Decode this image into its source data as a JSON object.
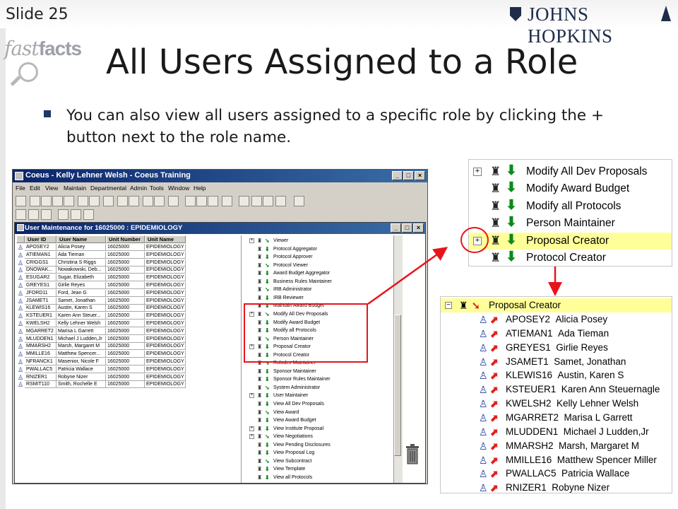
{
  "slide": {
    "number": "Slide 25",
    "brand": "JOHNS HOPKINS",
    "logo_left": "fast",
    "logo_right": "facts",
    "title": "All Users Assigned to a Role",
    "bullet": "You can also view all users assigned to a specific role by clicking the + button next to the role name."
  },
  "colors": {
    "accent_red": "#e8141a",
    "titlebar": "#0a246a",
    "highlight": "#ffff99",
    "green_arrow": "#0a8a1a"
  },
  "app": {
    "title": "Coeus  -  Kelly Lehner Welsh  -  Coeus Training",
    "menu": [
      "File",
      "Edit",
      "View",
      "Maintain",
      "Departmental",
      "Admin",
      "Tools",
      "Window",
      "Help"
    ],
    "inner_title": "User Maintenance for 16025000 : EPIDEMIOLOGY",
    "columns": [
      "User ID",
      "User Name",
      "Unit Number",
      "Unit Name"
    ],
    "users": [
      [
        "APOSEY2",
        "Alicia Posey",
        "16025000",
        "EPIDEMIOLOGY"
      ],
      [
        "ATIEMAN1",
        "Ada Tieman",
        "16025000",
        "EPIDEMIOLOGY"
      ],
      [
        "CRIGGS1",
        "Christina S Riggs",
        "16025000",
        "EPIDEMIOLOGY"
      ],
      [
        "DNOWAK...",
        "Nowakowski, Deb...",
        "16025000",
        "EPIDEMIOLOGY"
      ],
      [
        "ESUGAR2",
        "Sugar, Elizabeth",
        "16025000",
        "EPIDEMIOLOGY"
      ],
      [
        "GREYES1",
        "Girlie Reyes",
        "16025000",
        "EPIDEMIOLOGY"
      ],
      [
        "JFORD11",
        "Ford, Jean G",
        "16025000",
        "EPIDEMIOLOGY"
      ],
      [
        "JSAMET1",
        "Samet, Jonathan",
        "16025000",
        "EPIDEMIOLOGY"
      ],
      [
        "KLEWIS16",
        "Austin, Karen S",
        "16025000",
        "EPIDEMIOLOGY"
      ],
      [
        "KSTEUER1",
        "Karen Ann Steuer...",
        "16025000",
        "EPIDEMIOLOGY"
      ],
      [
        "KWELSH2",
        "Kelly Lehner Welsh",
        "16025000",
        "EPIDEMIOLOGY"
      ],
      [
        "MGARRET2",
        "Marisa L Garrett",
        "16025000",
        "EPIDEMIOLOGY"
      ],
      [
        "MLUDDEN1",
        "Michael J Ludden,Jr",
        "16025000",
        "EPIDEMIOLOGY"
      ],
      [
        "MMARSH2",
        "Marsh, Margaret M",
        "16025000",
        "EPIDEMIOLOGY"
      ],
      [
        "MMILLE16",
        "Matthew Spencer...",
        "16025000",
        "EPIDEMIOLOGY"
      ],
      [
        "NFRANCK1",
        "Masenior, Nicole F",
        "16025000",
        "EPIDEMIOLOGY"
      ],
      [
        "PWALLAC5",
        "Patricia Wallace",
        "16025000",
        "EPIDEMIOLOGY"
      ],
      [
        "RNIZER1",
        "Robyne Nizer",
        "16025000",
        "EPIDEMIOLOGY"
      ],
      [
        "RSMIT110",
        "Smith, Rochelle E",
        "16025000",
        "EPIDEMIOLOGY"
      ]
    ],
    "roles": [
      {
        "label": "Viewer",
        "plus": true
      },
      {
        "label": "Protocol Aggregator",
        "plus": false
      },
      {
        "label": "Protocol Approver",
        "plus": false
      },
      {
        "label": "Protocol Viewer",
        "plus": false
      },
      {
        "label": "Award Budget Aggregator",
        "plus": false
      },
      {
        "label": "Business Rules Maintainer",
        "plus": false
      },
      {
        "label": "IRB Administrator",
        "plus": false
      },
      {
        "label": "IRB Reviewer",
        "plus": false
      },
      {
        "label": "Maintain Award Budget",
        "plus": false
      },
      {
        "label": "Modify All Dev Proposals",
        "plus": true
      },
      {
        "label": "Modify Award Budget",
        "plus": false
      },
      {
        "label": "Modify all Protocols",
        "plus": false
      },
      {
        "label": "Person Maintainer",
        "plus": false
      },
      {
        "label": "Proposal Creator",
        "plus": true
      },
      {
        "label": "Protocol Creator",
        "plus": false
      },
      {
        "label": "Rolodex Maintainer",
        "plus": false
      },
      {
        "label": "Sponsor Maintainer",
        "plus": false
      },
      {
        "label": "Sponsor Rules Maintainer",
        "plus": false
      },
      {
        "label": "System Administrator",
        "plus": false
      },
      {
        "label": "User Maintainer",
        "plus": true
      },
      {
        "label": "View All Dev Proposals",
        "plus": false
      },
      {
        "label": "View Award",
        "plus": false
      },
      {
        "label": "View Award Budget",
        "plus": false
      },
      {
        "label": "View Institute Proposal",
        "plus": true
      },
      {
        "label": "View Negotiations",
        "plus": true
      },
      {
        "label": "View Pending Disclosures",
        "plus": false
      },
      {
        "label": "View Proposal Log",
        "plus": false
      },
      {
        "label": "View Subcontract",
        "plus": false
      },
      {
        "label": "View Template",
        "plus": false
      },
      {
        "label": "View all Protocols",
        "plus": false
      }
    ]
  },
  "zoom1": {
    "rows": [
      {
        "label": "Modify All Dev Proposals",
        "plus": true,
        "highlight": false
      },
      {
        "label": "Modify Award Budget",
        "plus": false,
        "highlight": false
      },
      {
        "label": "Modify all Protocols",
        "plus": false,
        "highlight": false
      },
      {
        "label": "Person Maintainer",
        "plus": false,
        "highlight": false
      },
      {
        "label": "Proposal Creator",
        "plus": true,
        "highlight": true
      },
      {
        "label": "Protocol Creator",
        "plus": false,
        "highlight": false
      }
    ]
  },
  "zoom2": {
    "role": "Proposal Creator",
    "members": [
      {
        "id": "APOSEY2",
        "name": "Alicia Posey"
      },
      {
        "id": "ATIEMAN1",
        "name": "Ada Tieman"
      },
      {
        "id": "GREYES1",
        "name": "Girlie Reyes"
      },
      {
        "id": "JSAMET1",
        "name": "Samet, Jonathan"
      },
      {
        "id": "KLEWIS16",
        "name": "Austin, Karen S"
      },
      {
        "id": "KSTEUER1",
        "name": "Karen Ann Steuernagle"
      },
      {
        "id": "KWELSH2",
        "name": "Kelly Lehner Welsh"
      },
      {
        "id": "MGARRET2",
        "name": "Marisa L Garrett"
      },
      {
        "id": "MLUDDEN1",
        "name": "Michael J Ludden,Jr"
      },
      {
        "id": "MMARSH2",
        "name": "Marsh, Margaret M"
      },
      {
        "id": "MMILLE16",
        "name": "Matthew Spencer Miller"
      },
      {
        "id": "PWALLAC5",
        "name": "Patricia Wallace"
      },
      {
        "id": "RNIZER1",
        "name": "Robyne Nizer"
      }
    ]
  }
}
